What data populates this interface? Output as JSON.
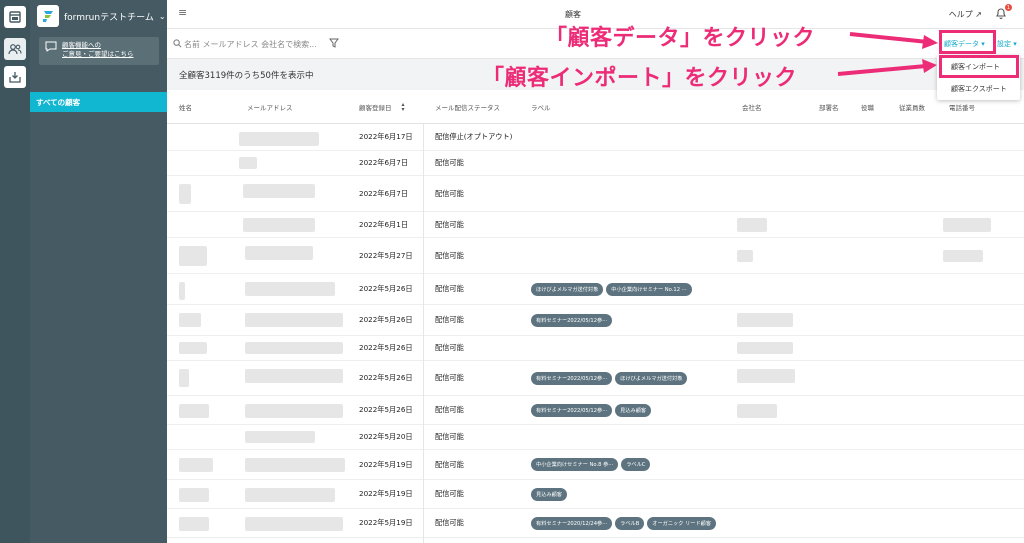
{
  "sidebar": {
    "team_name": "formrunテストチーム",
    "feedback_line1": "顧客機能への",
    "feedback_line2": "ご意見・ご要望はこちら",
    "nav_all": "すべての顧客"
  },
  "topbar": {
    "title": "顧客",
    "help": "ヘルプ",
    "notification_count": "1"
  },
  "search": {
    "placeholder": "名前 メールアドレス 会社名で検索...",
    "customer_data_label": "顧客データ ▾",
    "settings_label": "設定 ▾"
  },
  "summary": {
    "count_text": "全顧客3119件のうち50件を表示中"
  },
  "table": {
    "columns": {
      "name": "姓名",
      "email": "メールアドレス",
      "registered": "顧客登録日",
      "mail_status": "メール配信ステータス",
      "label": "ラベル",
      "company": "会社名",
      "department": "部署名",
      "position": "役職",
      "employees": "従業員数",
      "phone": "電話番号"
    },
    "rows": [
      {
        "date": "2022年6月17日",
        "status": "配信停止(オプトアウト)",
        "tags": []
      },
      {
        "date": "2022年6月7日",
        "status": "配信可能",
        "tags": []
      },
      {
        "date": "2022年6月7日",
        "status": "配信可能",
        "tags": []
      },
      {
        "date": "2022年6月1日",
        "status": "配信可能",
        "tags": []
      },
      {
        "date": "2022年5月27日",
        "status": "配信可能",
        "tags": []
      },
      {
        "date": "2022年5月26日",
        "status": "配信可能",
        "tags": [
          "ほけびよメルマガ送付対象",
          "中小企業向けセミナー No.12 ···"
        ]
      },
      {
        "date": "2022年5月26日",
        "status": "配信可能",
        "tags": [
          "有料セミナー2022/05/12参···"
        ]
      },
      {
        "date": "2022年5月26日",
        "status": "配信可能",
        "tags": []
      },
      {
        "date": "2022年5月26日",
        "status": "配信可能",
        "tags": [
          "有料セミナー2022/05/12参···",
          "ほけびよメルマガ送付対象"
        ]
      },
      {
        "date": "2022年5月26日",
        "status": "配信可能",
        "tags": [
          "有料セミナー2022/05/12参···",
          "見込み顧客"
        ]
      },
      {
        "date": "2022年5月20日",
        "status": "配信可能",
        "tags": []
      },
      {
        "date": "2022年5月19日",
        "status": "配信可能",
        "tags": [
          "中小企業向けセミナー No.8 参···",
          "ラベルC"
        ]
      },
      {
        "date": "2022年5月19日",
        "status": "配信可能",
        "tags": [
          "見込み顧客"
        ]
      },
      {
        "date": "2022年5月19日",
        "status": "配信可能",
        "tags": [
          "有料セミナー2020/12/24参···",
          "ラベルB",
          "オーガニック リード顧客"
        ]
      }
    ]
  },
  "dropdown": {
    "import": "顧客インポート",
    "export": "顧客エクスポート"
  },
  "annotations": {
    "click_customer_data": "「顧客データ」をクリック",
    "click_customer_import": "「顧客インポート」をクリック",
    "color": "#ec2c77"
  },
  "colors": {
    "sidebar": "#455a62",
    "rail": "#3f555d",
    "accent": "#11b6d1",
    "tag": "#5d7480"
  }
}
